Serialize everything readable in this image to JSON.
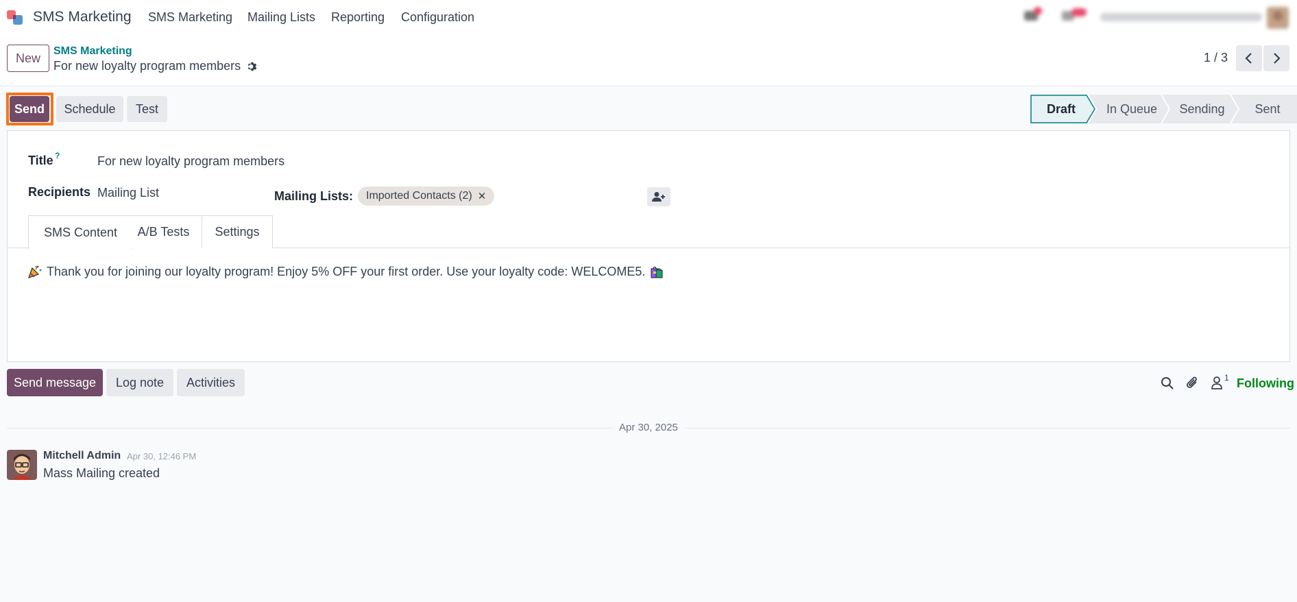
{
  "navbar": {
    "app_title": "SMS Marketing",
    "menu": [
      "SMS Marketing",
      "Mailing Lists",
      "Reporting",
      "Configuration"
    ]
  },
  "control": {
    "new_label": "New",
    "breadcrumb_parent": "SMS Marketing",
    "breadcrumb_current": "For new loyalty program members",
    "pager": "1 / 3"
  },
  "actions": {
    "send": "Send",
    "schedule": "Schedule",
    "test": "Test"
  },
  "statusbar": {
    "stages": [
      "Draft",
      "In Queue",
      "Sending",
      "Sent"
    ],
    "active": "Draft"
  },
  "form": {
    "title_label": "Title",
    "title_help": "?",
    "title_value": "For new loyalty program members",
    "recipients_label": "Recipients",
    "recipients_value": "Mailing List",
    "mailing_lists_label": "Mailing Lists:",
    "mailing_list_tag": "Imported Contacts (2)",
    "tag_remove": "✕"
  },
  "tabs": [
    "SMS Content",
    "A/B Tests",
    "Settings"
  ],
  "sms_content": {
    "text": "Thank you for joining our loyalty program! Enjoy 5% OFF your first order. Use your loyalty code: WELCOME5."
  },
  "chatter": {
    "send_message": "Send message",
    "log_note": "Log note",
    "activities": "Activities",
    "followers_count": "1",
    "following": "Following",
    "date_separator": "Apr 30, 2025",
    "message": {
      "author": "Mitchell Admin",
      "time": "Apr 30, 12:46 PM",
      "body": "Mass Mailing created"
    }
  },
  "colors": {
    "primary": "#714b67",
    "link": "#017e84",
    "following": "#008818",
    "highlight": "#f97316"
  }
}
